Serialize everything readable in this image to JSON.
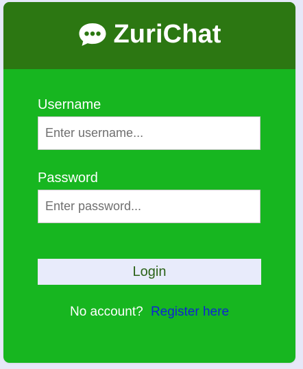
{
  "header": {
    "logo_icon": "chat-bubble-icon",
    "brand_name": "ZuriChat"
  },
  "login_form": {
    "username": {
      "label": "Username",
      "placeholder": "Enter username...",
      "value": ""
    },
    "password": {
      "label": "Password",
      "placeholder": "Enter password...",
      "value": ""
    },
    "login_label": "Login",
    "register_prompt": "No account?",
    "register_link": "Register here"
  },
  "colors": {
    "page_background": "#e6e8f8",
    "card_green": "#17b620",
    "header_green": "#2c7712",
    "button_background": "#e8ebfb",
    "button_text": "#2b6218",
    "link_blue": "#0e25d1"
  }
}
